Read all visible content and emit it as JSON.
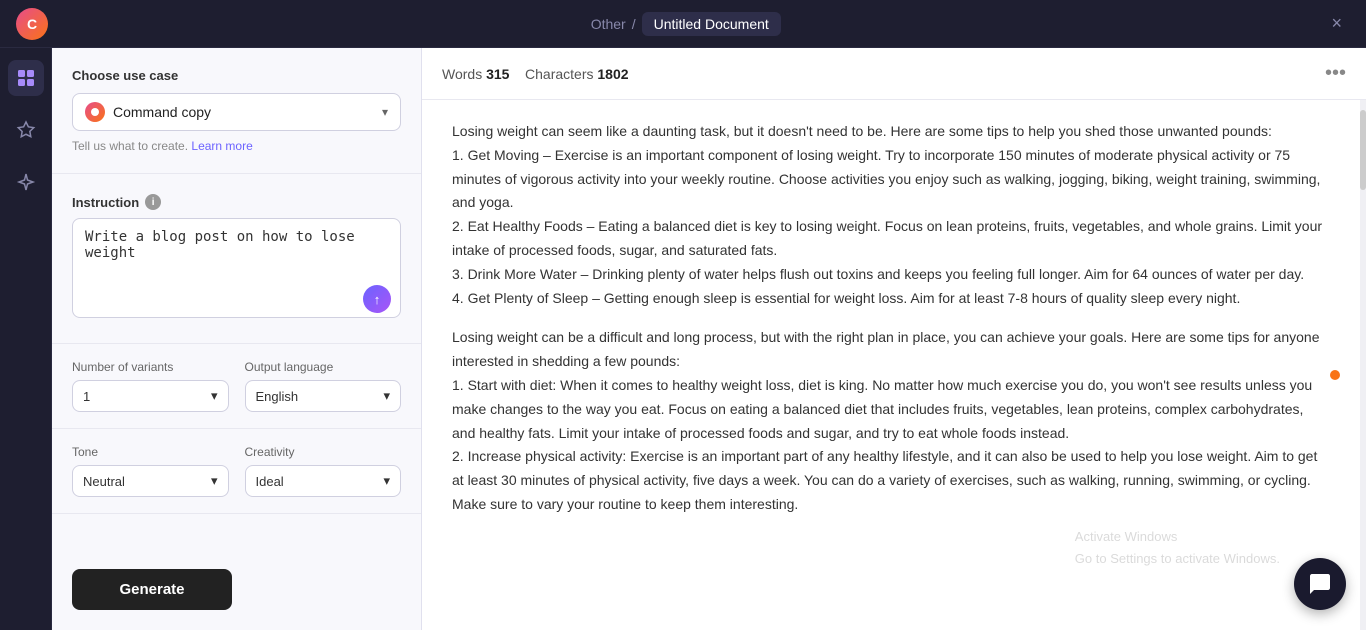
{
  "topbar": {
    "logo_text": "C",
    "breadcrumb_category": "Other",
    "breadcrumb_separator": "/",
    "doc_title": "Untitled Document",
    "close_label": "×"
  },
  "left_panel": {
    "use_case_label": "Choose use case",
    "use_case_value": "Command copy",
    "hint_prefix": "Tell us what to create.",
    "hint_link": "Learn more",
    "instruction_label": "Instruction",
    "instruction_placeholder": "Write a blog post on how to lose weight",
    "instruction_value": "Write a blog post on how to lose weight",
    "variants_label": "Number of variants",
    "variants_value": "1",
    "language_label": "Output language",
    "language_value": "English",
    "tone_label": "Tone",
    "tone_value": "Neutral",
    "creativity_label": "Creativity",
    "creativity_value": "Ideal",
    "generate_label": "Generate"
  },
  "doc_toolbar": {
    "words_label": "Words",
    "words_value": "315",
    "chars_label": "Characters",
    "chars_value": "1802",
    "more_dots": "•••"
  },
  "doc_content": {
    "paragraph1": "Losing weight can seem like a daunting task, but it doesn't need to be. Here are some tips to help you shed those unwanted pounds:\n1. Get Moving – Exercise is an important component of losing weight. Try to incorporate 150 minutes of moderate physical activity or 75 minutes of vigorous activity into your weekly routine. Choose activities you enjoy such as walking, jogging, biking, weight training, swimming, and yoga.\n2. Eat Healthy Foods – Eating a balanced diet is key to losing weight. Focus on lean proteins, fruits, vegetables, and whole grains. Limit your intake of processed foods, sugar, and saturated fats.\n3. Drink More Water – Drinking plenty of water helps flush out toxins and keeps you feeling full longer. Aim for 64 ounces of water per day.\n4. Get Plenty of Sleep – Getting enough sleep is essential for weight loss. Aim for at least 7-8 hours of quality sleep every night.",
    "paragraph2": "Losing weight can be a difficult and long process, but with the right plan in place, you can achieve your goals. Here are some tips for anyone interested in shedding a few pounds:\n1. Start with diet: When it comes to healthy weight loss, diet is king. No matter how much exercise you do, you won't see results unless you make changes to the way you eat. Focus on eating a balanced diet that includes fruits, vegetables, lean proteins, complex carbohydrates, and healthy fats. Limit your intake of processed foods and sugar, and try to eat whole foods instead.\n2. Increase physical activity: Exercise is an important part of any healthy lifestyle, and it can also be used to help you lose weight. Aim to get at least 30 minutes of physical activity, five days a week. You can do a variety of exercises, such as walking, running, swimming, or cycling. Make sure to vary your routine to keep them interesting.",
    "windows_watermark": "Activate Windows\nGo to Settings to activate Windows."
  },
  "icons": {
    "grid_icon": "⊞",
    "star_icon": "✦",
    "magic_icon": "✧",
    "chevron_down": "▾",
    "info": "i",
    "submit_arrow": "↑"
  }
}
